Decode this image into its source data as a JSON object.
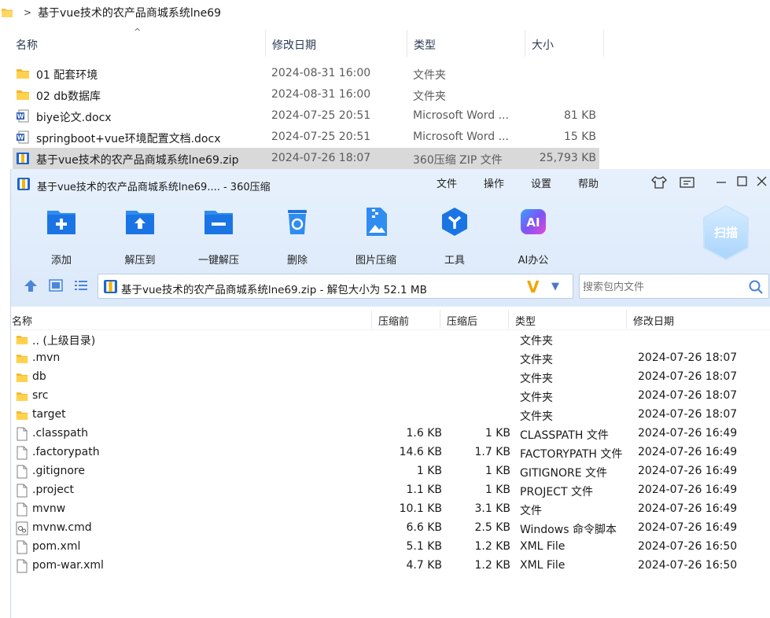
{
  "explorer": {
    "breadcrumb": "基于vue技术的农产品商城系统lne69",
    "columns": {
      "name": "名称",
      "modified": "修改日期",
      "type": "类型",
      "size": "大小"
    },
    "rows": [
      {
        "name": "01 配套环境",
        "modified": "2024-08-31 16:00",
        "type": "文件夹",
        "size": "",
        "icon": "folder-icon"
      },
      {
        "name": "02 db数据库",
        "modified": "2024-08-31 16:00",
        "type": "文件夹",
        "size": "",
        "icon": "folder-icon"
      },
      {
        "name": "biye论文.docx",
        "modified": "2024-07-25 20:51",
        "type": "Microsoft Word ...",
        "size": "81 KB",
        "icon": "word-doc-icon"
      },
      {
        "name": "springboot+vue环境配置文档.docx",
        "modified": "2024-07-25 20:51",
        "type": "Microsoft Word ...",
        "size": "15 KB",
        "icon": "word-doc-icon"
      },
      {
        "name": "基于vue技术的农产品商城系统lne69.zip",
        "modified": "2024-07-26 18:07",
        "type": "360压缩 ZIP 文件",
        "size": "25,793 KB",
        "icon": "zip-archive-icon",
        "selected": true
      }
    ]
  },
  "zip": {
    "title": "基于vue技术的农产品商城系统lne69.... - 360压缩",
    "menu": [
      "文件",
      "操作",
      "设置",
      "帮助"
    ],
    "toolbar": {
      "add": "添加",
      "extract_to": "解压到",
      "one_click_extract": "一键解压",
      "delete": "删除",
      "image_compress": "图片压缩",
      "tools": "工具",
      "ai_office": "AI办公"
    },
    "scan_label": "扫描",
    "ai_badge": "AI",
    "path_text": "基于vue技术的农产品商城系统lne69.zip - 解包大小为 52.1 MB",
    "search_placeholder": "搜索包内文件",
    "columns": {
      "name": "名称",
      "orig_size": "压缩前",
      "comp_size": "压缩后",
      "type": "类型",
      "modified": "修改日期"
    },
    "rows": [
      {
        "name": ".. (上级目录)",
        "orig": "",
        "comp": "",
        "type": "文件夹",
        "date": "",
        "kind": "folder"
      },
      {
        "name": ".mvn",
        "orig": "",
        "comp": "",
        "type": "文件夹",
        "date": "2024-07-26 18:07",
        "kind": "folder"
      },
      {
        "name": "db",
        "orig": "",
        "comp": "",
        "type": "文件夹",
        "date": "2024-07-26 18:07",
        "kind": "folder"
      },
      {
        "name": "src",
        "orig": "",
        "comp": "",
        "type": "文件夹",
        "date": "2024-07-26 18:07",
        "kind": "folder"
      },
      {
        "name": "target",
        "orig": "",
        "comp": "",
        "type": "文件夹",
        "date": "2024-07-26 18:07",
        "kind": "folder"
      },
      {
        "name": ".classpath",
        "orig": "1.6 KB",
        "comp": "1 KB",
        "type": "CLASSPATH 文件",
        "date": "2024-07-26 16:49",
        "kind": "file"
      },
      {
        "name": ".factorypath",
        "orig": "14.6 KB",
        "comp": "1.7 KB",
        "type": "FACTORYPATH 文件",
        "date": "2024-07-26 16:49",
        "kind": "file"
      },
      {
        "name": ".gitignore",
        "orig": "1 KB",
        "comp": "1 KB",
        "type": "GITIGNORE 文件",
        "date": "2024-07-26 16:49",
        "kind": "file"
      },
      {
        "name": ".project",
        "orig": "1.1 KB",
        "comp": "1 KB",
        "type": "PROJECT 文件",
        "date": "2024-07-26 16:49",
        "kind": "file"
      },
      {
        "name": "mvnw",
        "orig": "10.1 KB",
        "comp": "3.1 KB",
        "type": "文件",
        "date": "2024-07-26 16:49",
        "kind": "file"
      },
      {
        "name": "mvnw.cmd",
        "orig": "6.6 KB",
        "comp": "2.5 KB",
        "type": "Windows 命令脚本",
        "date": "2024-07-26 16:49",
        "kind": "cmd"
      },
      {
        "name": "pom.xml",
        "orig": "5.1 KB",
        "comp": "1.2 KB",
        "type": "XML File",
        "date": "2024-07-26 16:50",
        "kind": "file"
      },
      {
        "name": "pom-war.xml",
        "orig": "4.7 KB",
        "comp": "1.2 KB",
        "type": "XML File",
        "date": "2024-07-26 16:50",
        "kind": "file"
      }
    ]
  }
}
